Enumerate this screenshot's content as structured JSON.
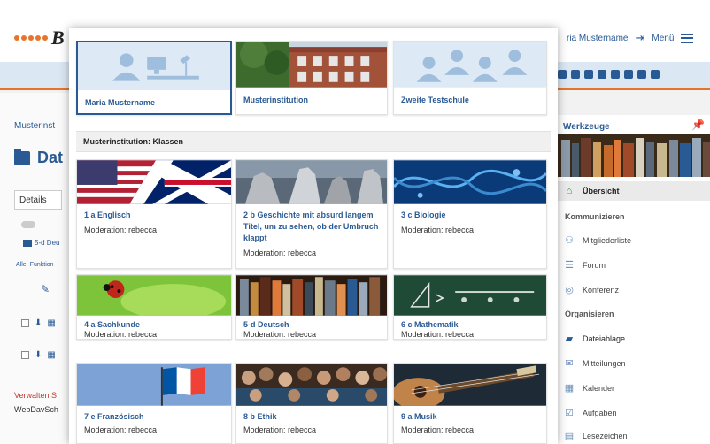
{
  "header": {
    "logo_letter": "B",
    "user_name": "ria Mustername",
    "logout_icon": "logout-icon",
    "menu_label": "Menü"
  },
  "background": {
    "breadcrumb": "Musterinst",
    "page_title": "Dat",
    "details_tab": "Details",
    "folder_link": "5-d Deu",
    "filter_all": "Alle",
    "filter_functions": "Funktion",
    "manage_link": "Verwalten S",
    "webdav": "WebDavSch"
  },
  "sidebar": {
    "title": "Werkzeuge",
    "items": [
      {
        "label": "Übersicht",
        "icon": "home-icon"
      },
      {
        "label": "Kommunizieren",
        "heading": true
      },
      {
        "label": "Mitgliederliste",
        "icon": "members-icon"
      },
      {
        "label": "Forum",
        "icon": "forum-icon"
      },
      {
        "label": "Konferenz",
        "icon": "conference-icon"
      },
      {
        "label": "Organisieren",
        "heading": true
      },
      {
        "label": "Dateiablage",
        "icon": "files-icon"
      },
      {
        "label": "Mitteilungen",
        "icon": "messages-icon"
      },
      {
        "label": "Kalender",
        "icon": "calendar-icon"
      },
      {
        "label": "Aufgaben",
        "icon": "tasks-icon"
      },
      {
        "label": "Lesezeichen",
        "icon": "bookmark-icon"
      }
    ]
  },
  "overlay": {
    "top_cards": [
      {
        "title": "Maria Mustername"
      },
      {
        "title": "Musterinstitution"
      },
      {
        "title": "Zweite Testschule"
      }
    ],
    "section_title": "Musterinstitution: Klassen",
    "classes": [
      {
        "title": "1 a Englisch",
        "moderation": "Moderation: rebecca"
      },
      {
        "title": "2 b Geschichte mit absurd langem Titel, um zu sehen, ob der Umbruch klappt",
        "moderation": "Moderation: rebecca"
      },
      {
        "title": "3 c Biologie",
        "moderation": "Moderation: rebecca"
      },
      {
        "title": "4 a Sachkunde",
        "moderation": "Moderation: rebecca"
      },
      {
        "title": "5-d Deutsch",
        "moderation": "Moderation: rebecca"
      },
      {
        "title": "6 c Mathematik",
        "moderation": "Moderation: rebecca"
      },
      {
        "title": "7 e Französisch",
        "moderation": "Moderation: rebecca"
      },
      {
        "title": "8 b Ethik",
        "moderation": "Moderation: rebecca"
      },
      {
        "title": "9 a Musik",
        "moderation": "Moderation: rebecca"
      }
    ]
  },
  "colors": {
    "primary": "#2a5a94",
    "accent": "#e8742b",
    "link_red": "#c0392b"
  }
}
